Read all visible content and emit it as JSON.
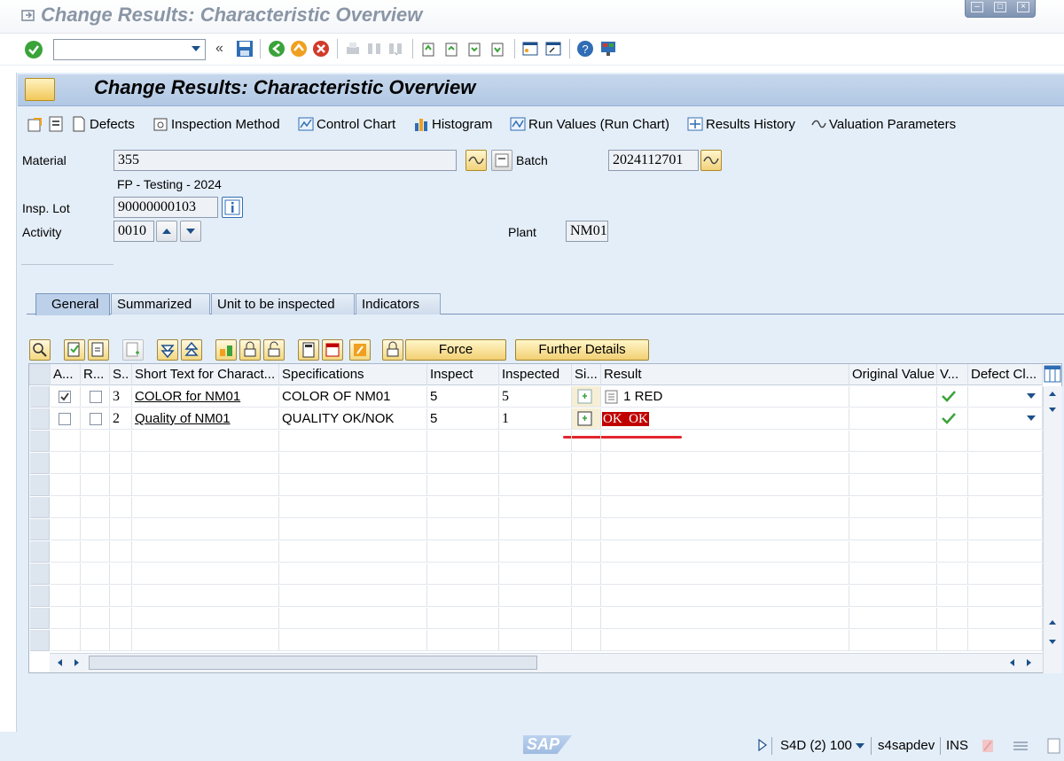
{
  "window": {
    "title": "Change Results: Characteristic Overview"
  },
  "command_field": {
    "value": "",
    "placeholder": ""
  },
  "header": {
    "title": "Change Results: Characteristic Overview"
  },
  "app_toolbar": {
    "defects": "Defects",
    "inspection_method": "Inspection Method",
    "control_chart": "Control Chart",
    "histogram": "Histogram",
    "run_values": "Run Values (Run Chart)",
    "results_history": "Results History",
    "valuation_parameters": "Valuation Parameters"
  },
  "form": {
    "material_label": "Material",
    "material_value": "355",
    "material_desc": "FP - Testing - 2024",
    "batch_label": "Batch",
    "batch_value": "2024112701",
    "insp_lot_label": "Insp. Lot",
    "insp_lot_value": "90000000103",
    "activity_label": "Activity",
    "activity_value": "0010",
    "plant_label": "Plant",
    "plant_value": "NM01"
  },
  "tabs": [
    "General",
    "Summarized",
    "Unit to be inspected",
    "Indicators"
  ],
  "grid_buttons": {
    "force": "Force",
    "further_details": "Further Details"
  },
  "table": {
    "columns": [
      "A...",
      "R...",
      "S..",
      "Short Text for Charact...",
      "Specifications",
      "Inspect",
      "Inspected",
      "Si...",
      "Result",
      "Original Value",
      "V...",
      "Defect Cl..."
    ],
    "rows": [
      {
        "a_checked": true,
        "r_checked": false,
        "seq": "3",
        "short_text": "COLOR for NM01",
        "spec": "COLOR OF NM01",
        "inspect": "5",
        "inspected": "5",
        "result": "1 RED",
        "valuation": "accepted"
      },
      {
        "a_checked": false,
        "r_checked": false,
        "seq": "2",
        "short_text": "Quality of NM01",
        "spec": "QUALITY OK/NOK",
        "inspect": "5",
        "inspected": "1",
        "result": "OK  OK",
        "valuation": "accepted"
      }
    ]
  },
  "status_bar": {
    "system": "S4D (2) 100",
    "server": "s4sapdev",
    "mode": "INS",
    "logo": "SAP"
  },
  "colors": {
    "accent": "#1d4f8a",
    "highlight_red": "#c00000",
    "underline_red": "#e3262d",
    "ok_green": "#3aa33a"
  }
}
